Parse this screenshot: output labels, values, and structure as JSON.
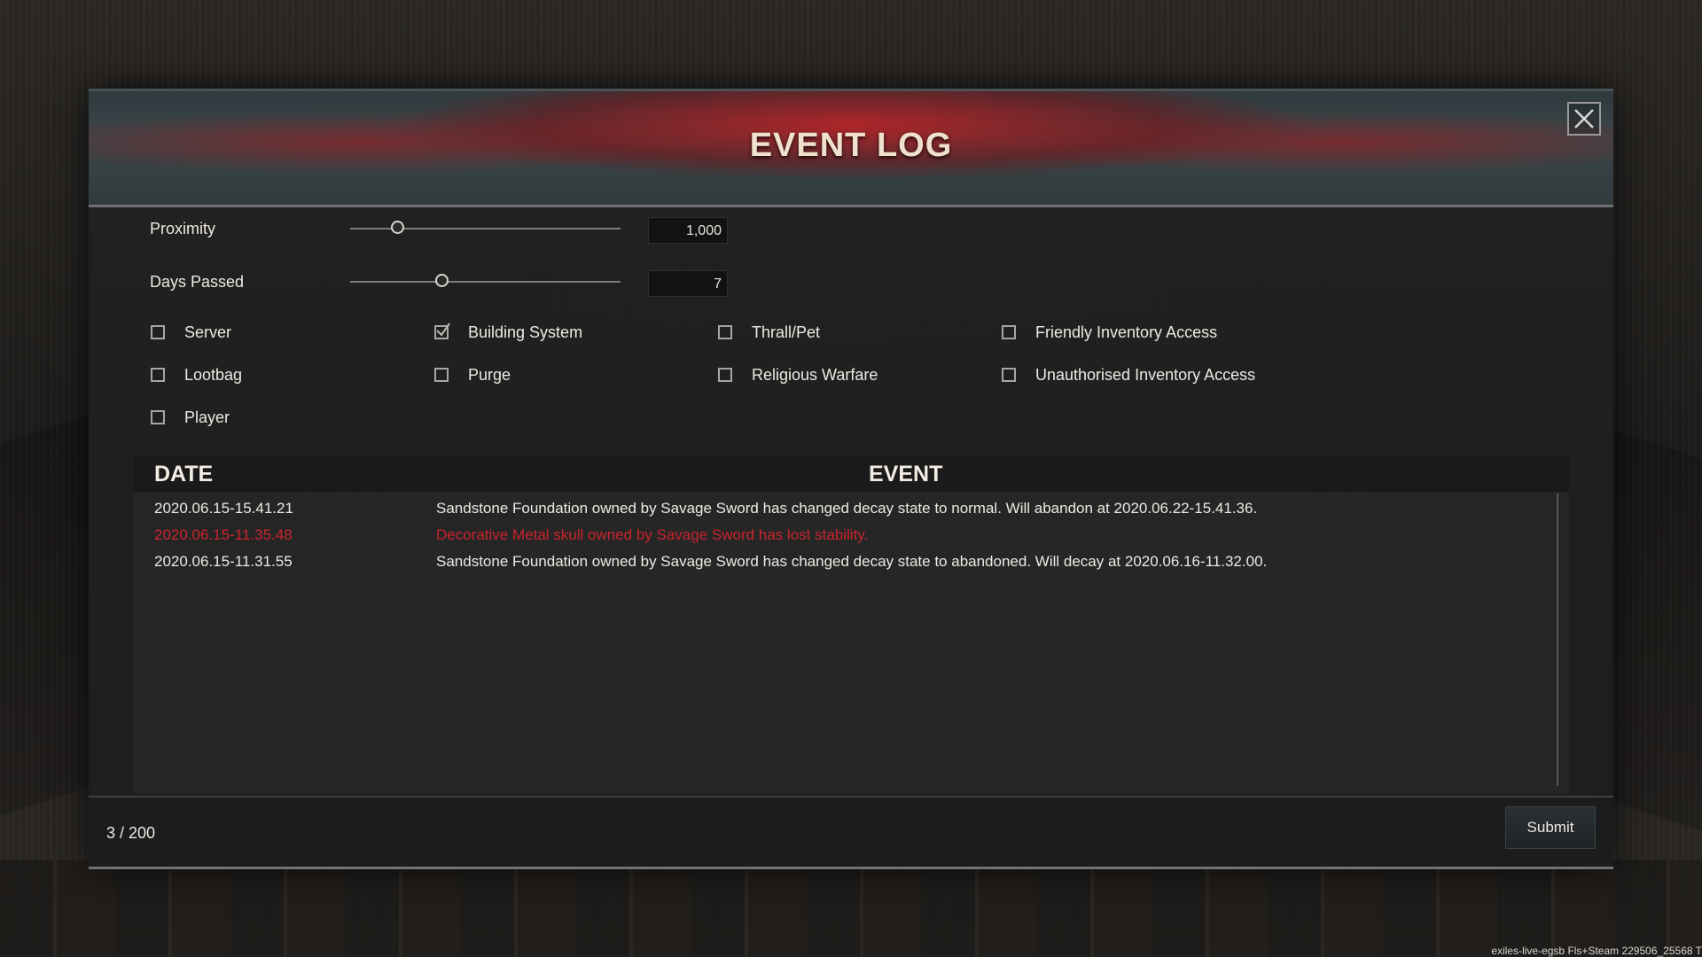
{
  "dialog": {
    "title": "EVENT LOG",
    "close_icon": "close-icon"
  },
  "filters": {
    "proximity": {
      "label": "Proximity",
      "value": "1,000",
      "slider_level": 0.16
    },
    "days_passed": {
      "label": "Days Passed",
      "value": "7",
      "slider_level": 0.33
    }
  },
  "categories": [
    {
      "label": "Server",
      "checked": false
    },
    {
      "label": "Building System",
      "checked": true
    },
    {
      "label": "Thrall/Pet",
      "checked": false
    },
    {
      "label": "Friendly Inventory Access",
      "checked": false
    },
    {
      "label": "Lootbag",
      "checked": false
    },
    {
      "label": "Purge",
      "checked": false
    },
    {
      "label": "Religious Warfare",
      "checked": false
    },
    {
      "label": "Unauthorised Inventory Access",
      "checked": false
    },
    {
      "label": "Player",
      "checked": false
    }
  ],
  "table": {
    "headers": {
      "date": "DATE",
      "event": "EVENT"
    },
    "rows": [
      {
        "date": "2020.06.15-15.41.21",
        "event": "Sandstone Foundation owned by Savage Sword has changed decay state to normal. Will abandon at 2020.06.22-15.41.36.",
        "highlight": false
      },
      {
        "date": "2020.06.15-11.35.48",
        "event": "Decorative Metal skull owned by Savage Sword has lost stability.",
        "highlight": true
      },
      {
        "date": "2020.06.15-11.31.55",
        "event": "Sandstone Foundation owned by Savage Sword has changed decay state to abandoned. Will decay at 2020.06.16-11.32.00.",
        "highlight": false
      }
    ]
  },
  "footer": {
    "count": "3 / 200",
    "submit_label": "Submit"
  },
  "build_info": "exiles-live-egsb Fls+Steam 229506_25568 T",
  "colors": {
    "accent_red": "#c9242b",
    "header_red": "#b42428",
    "text": "#eeeae2"
  }
}
